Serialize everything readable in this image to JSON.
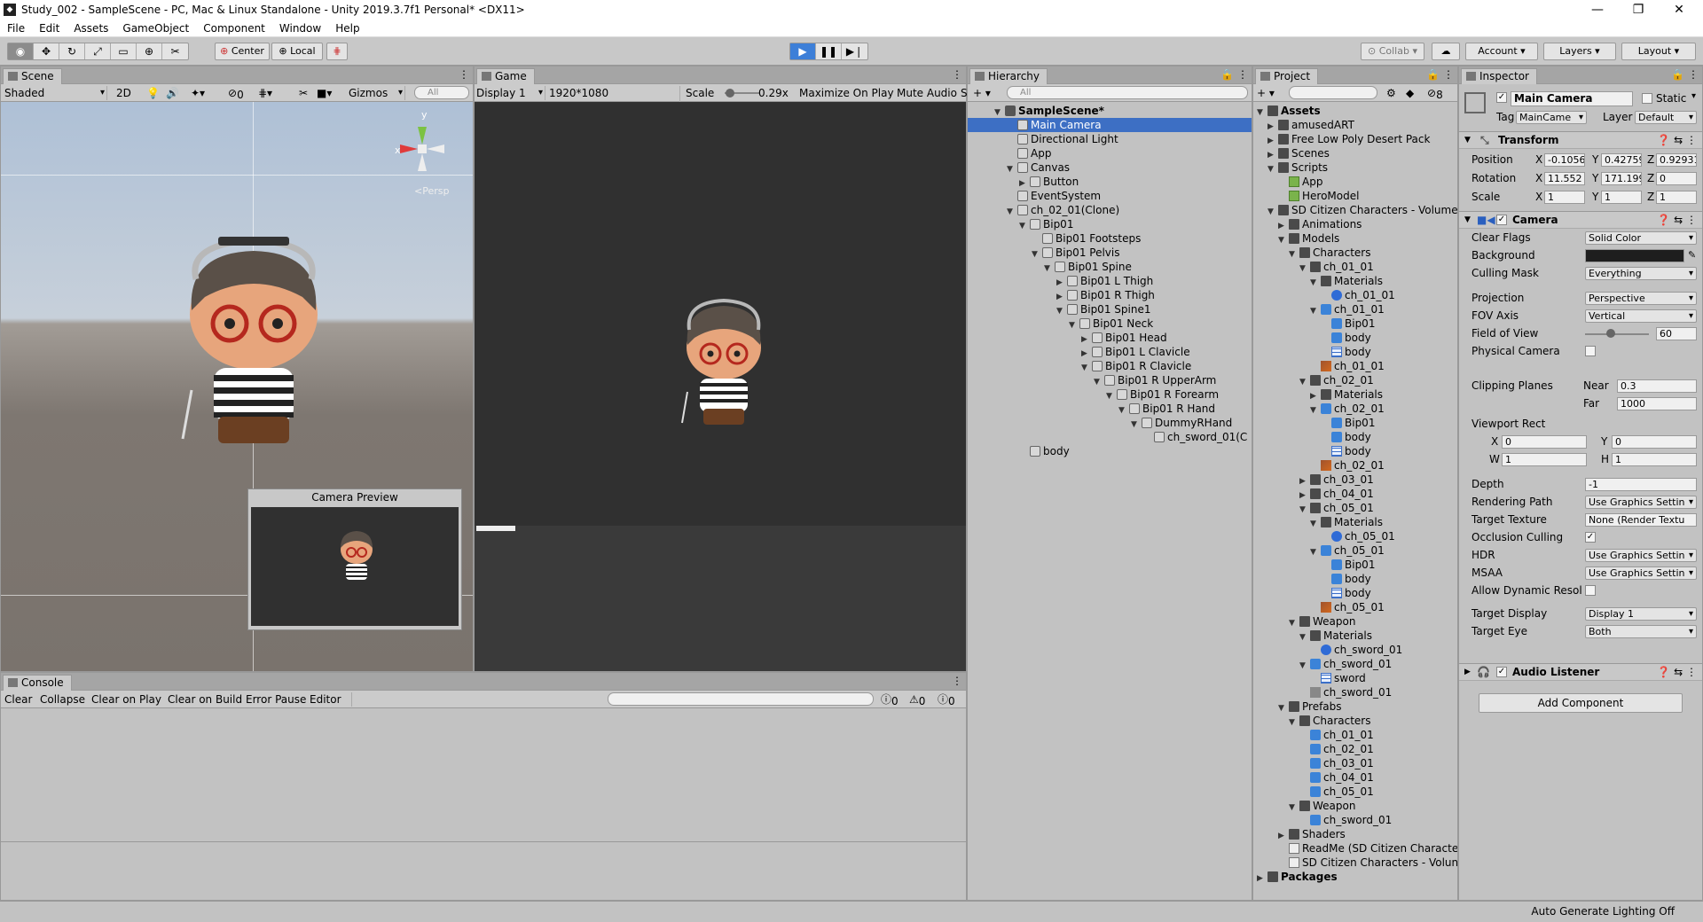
{
  "window": {
    "title": "Study_002 - SampleScene - PC, Mac & Linux Standalone - Unity 2019.3.7f1 Personal* <DX11>"
  },
  "menu": [
    "File",
    "Edit",
    "Assets",
    "GameObject",
    "Component",
    "Window",
    "Help"
  ],
  "toolbar": {
    "pivot": "Center",
    "space": "Local",
    "collab": "Collab",
    "account": "Account",
    "layers": "Layers",
    "layout": "Layout"
  },
  "scene": {
    "tab": "Scene",
    "shading": "Shaded",
    "mode2d": "2D",
    "fx_count": "0",
    "gizmos": "Gizmos",
    "search_placeholder": "All",
    "persp": "Persp",
    "axis_y": "y",
    "axis_x": "x",
    "camera_preview": "Camera Preview"
  },
  "game": {
    "tab": "Game",
    "display": "Display 1",
    "resolution": "1920*1080 (1920x1080)",
    "scale_label": "Scale",
    "scale_value": "0.29x",
    "maximize": "Maximize On Play",
    "mute": "Mute Audio",
    "stats": "S"
  },
  "console": {
    "tab": "Console",
    "clear": "Clear",
    "collapse": "Collapse",
    "clear_on_play": "Clear on Play",
    "clear_on_build": "Clear on Build",
    "error_pause": "Error Pause",
    "editor": "Editor",
    "info_count": "0",
    "warn_count": "0",
    "error_count": "0"
  },
  "hierarchy": {
    "tab": "Hierarchy",
    "search_placeholder": "All",
    "rows": [
      {
        "label": "SampleScene*",
        "depth": 0,
        "arrow": "▼",
        "icon": "scene",
        "bold": true
      },
      {
        "label": "Main Camera",
        "depth": 1,
        "arrow": "",
        "icon": "go",
        "selected": true
      },
      {
        "label": "Directional Light",
        "depth": 1,
        "arrow": "",
        "icon": "go"
      },
      {
        "label": "App",
        "depth": 1,
        "arrow": "",
        "icon": "go"
      },
      {
        "label": "Canvas",
        "depth": 1,
        "arrow": "▼",
        "icon": "go"
      },
      {
        "label": "Button",
        "depth": 2,
        "arrow": "▶",
        "icon": "go"
      },
      {
        "label": "EventSystem",
        "depth": 1,
        "arrow": "",
        "icon": "go"
      },
      {
        "label": "ch_02_01(Clone)",
        "depth": 1,
        "arrow": "▼",
        "icon": "go"
      },
      {
        "label": "Bip01",
        "depth": 2,
        "arrow": "▼",
        "icon": "go"
      },
      {
        "label": "Bip01 Footsteps",
        "depth": 3,
        "arrow": "",
        "icon": "go"
      },
      {
        "label": "Bip01 Pelvis",
        "depth": 3,
        "arrow": "▼",
        "icon": "go"
      },
      {
        "label": "Bip01 Spine",
        "depth": 4,
        "arrow": "▼",
        "icon": "go"
      },
      {
        "label": "Bip01 L Thigh",
        "depth": 5,
        "arrow": "▶",
        "icon": "go"
      },
      {
        "label": "Bip01 R Thigh",
        "depth": 5,
        "arrow": "▶",
        "icon": "go"
      },
      {
        "label": "Bip01 Spine1",
        "depth": 5,
        "arrow": "▼",
        "icon": "go"
      },
      {
        "label": "Bip01 Neck",
        "depth": 6,
        "arrow": "▼",
        "icon": "go"
      },
      {
        "label": "Bip01 Head",
        "depth": 7,
        "arrow": "▶",
        "icon": "go"
      },
      {
        "label": "Bip01 L Clavicle",
        "depth": 7,
        "arrow": "▶",
        "icon": "go"
      },
      {
        "label": "Bip01 R Clavicle",
        "depth": 7,
        "arrow": "▼",
        "icon": "go"
      },
      {
        "label": "Bip01 R UpperArm",
        "depth": 8,
        "arrow": "▼",
        "icon": "go"
      },
      {
        "label": "Bip01 R Forearm",
        "depth": 9,
        "arrow": "▼",
        "icon": "go"
      },
      {
        "label": "Bip01 R Hand",
        "depth": 10,
        "arrow": "▼",
        "icon": "go"
      },
      {
        "label": "DummyRHand",
        "depth": 11,
        "arrow": "▼",
        "icon": "go"
      },
      {
        "label": "ch_sword_01(C",
        "depth": 12,
        "arrow": "",
        "icon": "go"
      },
      {
        "label": "body",
        "depth": 2,
        "arrow": "",
        "icon": "go"
      }
    ]
  },
  "project": {
    "tab": "Project",
    "badge": "8",
    "rows": [
      {
        "label": "Assets",
        "depth": 0,
        "arrow": "▼",
        "icon": "folder",
        "bold": true
      },
      {
        "label": "amusedART",
        "depth": 1,
        "arrow": "▶",
        "icon": "folder"
      },
      {
        "label": "Free Low Poly Desert Pack",
        "depth": 1,
        "arrow": "▶",
        "icon": "folder"
      },
      {
        "label": "Scenes",
        "depth": 1,
        "arrow": "▶",
        "icon": "folder"
      },
      {
        "label": "Scripts",
        "depth": 1,
        "arrow": "▼",
        "icon": "folder"
      },
      {
        "label": "App",
        "depth": 2,
        "arrow": "",
        "icon": "script"
      },
      {
        "label": "HeroModel",
        "depth": 2,
        "arrow": "",
        "icon": "script"
      },
      {
        "label": "SD Citizen Characters - Volume",
        "depth": 1,
        "arrow": "▼",
        "icon": "folder"
      },
      {
        "label": "Animations",
        "depth": 2,
        "arrow": "▶",
        "icon": "folder"
      },
      {
        "label": "Models",
        "depth": 2,
        "arrow": "▼",
        "icon": "folder"
      },
      {
        "label": "Characters",
        "depth": 3,
        "arrow": "▼",
        "icon": "folder"
      },
      {
        "label": "ch_01_01",
        "depth": 4,
        "arrow": "▼",
        "icon": "folder"
      },
      {
        "label": "Materials",
        "depth": 5,
        "arrow": "▼",
        "icon": "folder"
      },
      {
        "label": "ch_01_01",
        "depth": 6,
        "arrow": "",
        "icon": "mat"
      },
      {
        "label": "ch_01_01",
        "depth": 5,
        "arrow": "▼",
        "icon": "prefab"
      },
      {
        "label": "Bip01",
        "depth": 6,
        "arrow": "",
        "icon": "prefab"
      },
      {
        "label": "body",
        "depth": 6,
        "arrow": "",
        "icon": "prefab"
      },
      {
        "label": "body",
        "depth": 6,
        "arrow": "",
        "icon": "mesh"
      },
      {
        "label": "ch_01_01",
        "depth": 5,
        "arrow": "",
        "icon": "tex"
      },
      {
        "label": "ch_02_01",
        "depth": 4,
        "arrow": "▼",
        "icon": "folder"
      },
      {
        "label": "Materials",
        "depth": 5,
        "arrow": "▶",
        "icon": "folder"
      },
      {
        "label": "ch_02_01",
        "depth": 5,
        "arrow": "▼",
        "icon": "prefab"
      },
      {
        "label": "Bip01",
        "depth": 6,
        "arrow": "",
        "icon": "prefab"
      },
      {
        "label": "body",
        "depth": 6,
        "arrow": "",
        "icon": "prefab"
      },
      {
        "label": "body",
        "depth": 6,
        "arrow": "",
        "icon": "mesh"
      },
      {
        "label": "ch_02_01",
        "depth": 5,
        "arrow": "",
        "icon": "tex"
      },
      {
        "label": "ch_03_01",
        "depth": 4,
        "arrow": "▶",
        "icon": "folder"
      },
      {
        "label": "ch_04_01",
        "depth": 4,
        "arrow": "▶",
        "icon": "folder"
      },
      {
        "label": "ch_05_01",
        "depth": 4,
        "arrow": "▼",
        "icon": "folder"
      },
      {
        "label": "Materials",
        "depth": 5,
        "arrow": "▼",
        "icon": "folder"
      },
      {
        "label": "ch_05_01",
        "depth": 6,
        "arrow": "",
        "icon": "mat"
      },
      {
        "label": "ch_05_01",
        "depth": 5,
        "arrow": "▼",
        "icon": "prefab"
      },
      {
        "label": "Bip01",
        "depth": 6,
        "arrow": "",
        "icon": "prefab"
      },
      {
        "label": "body",
        "depth": 6,
        "arrow": "",
        "icon": "prefab"
      },
      {
        "label": "body",
        "depth": 6,
        "arrow": "",
        "icon": "mesh"
      },
      {
        "label": "ch_05_01",
        "depth": 5,
        "arrow": "",
        "icon": "tex"
      },
      {
        "label": "Weapon",
        "depth": 3,
        "arrow": "▼",
        "icon": "folder"
      },
      {
        "label": "Materials",
        "depth": 4,
        "arrow": "▼",
        "icon": "folder"
      },
      {
        "label": "ch_sword_01",
        "depth": 5,
        "arrow": "",
        "icon": "mat"
      },
      {
        "label": "ch_sword_01",
        "depth": 4,
        "arrow": "▼",
        "icon": "prefab"
      },
      {
        "label": "sword",
        "depth": 5,
        "arrow": "",
        "icon": "mesh"
      },
      {
        "label": "ch_sword_01",
        "depth": 4,
        "arrow": "",
        "icon": "anim"
      },
      {
        "label": "Prefabs",
        "depth": 2,
        "arrow": "▼",
        "icon": "folder"
      },
      {
        "label": "Characters",
        "depth": 3,
        "arrow": "▼",
        "icon": "folder"
      },
      {
        "label": "ch_01_01",
        "depth": 4,
        "arrow": "",
        "icon": "prefab"
      },
      {
        "label": "ch_02_01",
        "depth": 4,
        "arrow": "",
        "icon": "prefab"
      },
      {
        "label": "ch_03_01",
        "depth": 4,
        "arrow": "",
        "icon": "prefab"
      },
      {
        "label": "ch_04_01",
        "depth": 4,
        "arrow": "",
        "icon": "prefab"
      },
      {
        "label": "ch_05_01",
        "depth": 4,
        "arrow": "",
        "icon": "prefab"
      },
      {
        "label": "Weapon",
        "depth": 3,
        "arrow": "▼",
        "icon": "folder"
      },
      {
        "label": "ch_sword_01",
        "depth": 4,
        "arrow": "",
        "icon": "prefab"
      },
      {
        "label": "Shaders",
        "depth": 2,
        "arrow": "▶",
        "icon": "folder"
      },
      {
        "label": "ReadMe (SD Citizen Characte",
        "depth": 2,
        "arrow": "",
        "icon": "doc"
      },
      {
        "label": "SD Citizen Characters - Volun",
        "depth": 2,
        "arrow": "",
        "icon": "doc"
      },
      {
        "label": "Packages",
        "depth": 0,
        "arrow": "▶",
        "icon": "folder",
        "bold": true
      }
    ]
  },
  "inspector": {
    "tab": "Inspector",
    "object_name": "Main Camera",
    "static": "Static",
    "tag_label": "Tag",
    "tag_value": "MainCame",
    "layer_label": "Layer",
    "layer_value": "Default",
    "transform": {
      "title": "Transform",
      "position_label": "Position",
      "pos_x": "-0.1056",
      "pos_y": "0.42759",
      "pos_z": "0.92931",
      "rotation_label": "Rotation",
      "rot_x": "11.552",
      "rot_y": "171.199",
      "rot_z": "0",
      "scale_label": "Scale",
      "scale_x": "1",
      "scale_y": "1",
      "scale_z": "1",
      "x": "X",
      "y": "Y",
      "z": "Z"
    },
    "camera": {
      "title": "Camera",
      "clear_flags_label": "Clear Flags",
      "clear_flags": "Solid Color",
      "background_label": "Background",
      "culling_mask_label": "Culling Mask",
      "culling_mask": "Everything",
      "projection_label": "Projection",
      "projection": "Perspective",
      "fov_axis_label": "FOV Axis",
      "fov_axis": "Vertical",
      "fov_label": "Field of View",
      "fov": "60",
      "physical_label": "Physical Camera",
      "clipping_label": "Clipping Planes",
      "near_label": "Near",
      "near": "0.3",
      "far_label": "Far",
      "far": "1000",
      "viewport_label": "Viewport Rect",
      "vx_label": "X",
      "vx": "0",
      "vy_label": "Y",
      "vy": "0",
      "vw_label": "W",
      "vw": "1",
      "vh_label": "H",
      "vh": "1",
      "depth_label": "Depth",
      "depth": "-1",
      "rendering_path_label": "Rendering Path",
      "rendering_path": "Use Graphics Settin",
      "target_texture_label": "Target Texture",
      "target_texture": "None (Render Textu",
      "occlusion_label": "Occlusion Culling",
      "hdr_label": "HDR",
      "hdr": "Use Graphics Settin",
      "msaa_label": "MSAA",
      "msaa": "Use Graphics Settin",
      "dynres_label": "Allow Dynamic Resol",
      "target_display_label": "Target Display",
      "target_display": "Display 1",
      "target_eye_label": "Target Eye",
      "target_eye": "Both"
    },
    "audio_listener": "Audio Listener",
    "add_component": "Add Component"
  },
  "status": {
    "lighting": "Auto Generate Lighting Off"
  },
  "colors": {
    "selection": "#3d6fc4",
    "play_active": "#3d7fd8",
    "sky": "#b4c4d8",
    "ground": "#7e7771",
    "game_bg": "#303030"
  }
}
